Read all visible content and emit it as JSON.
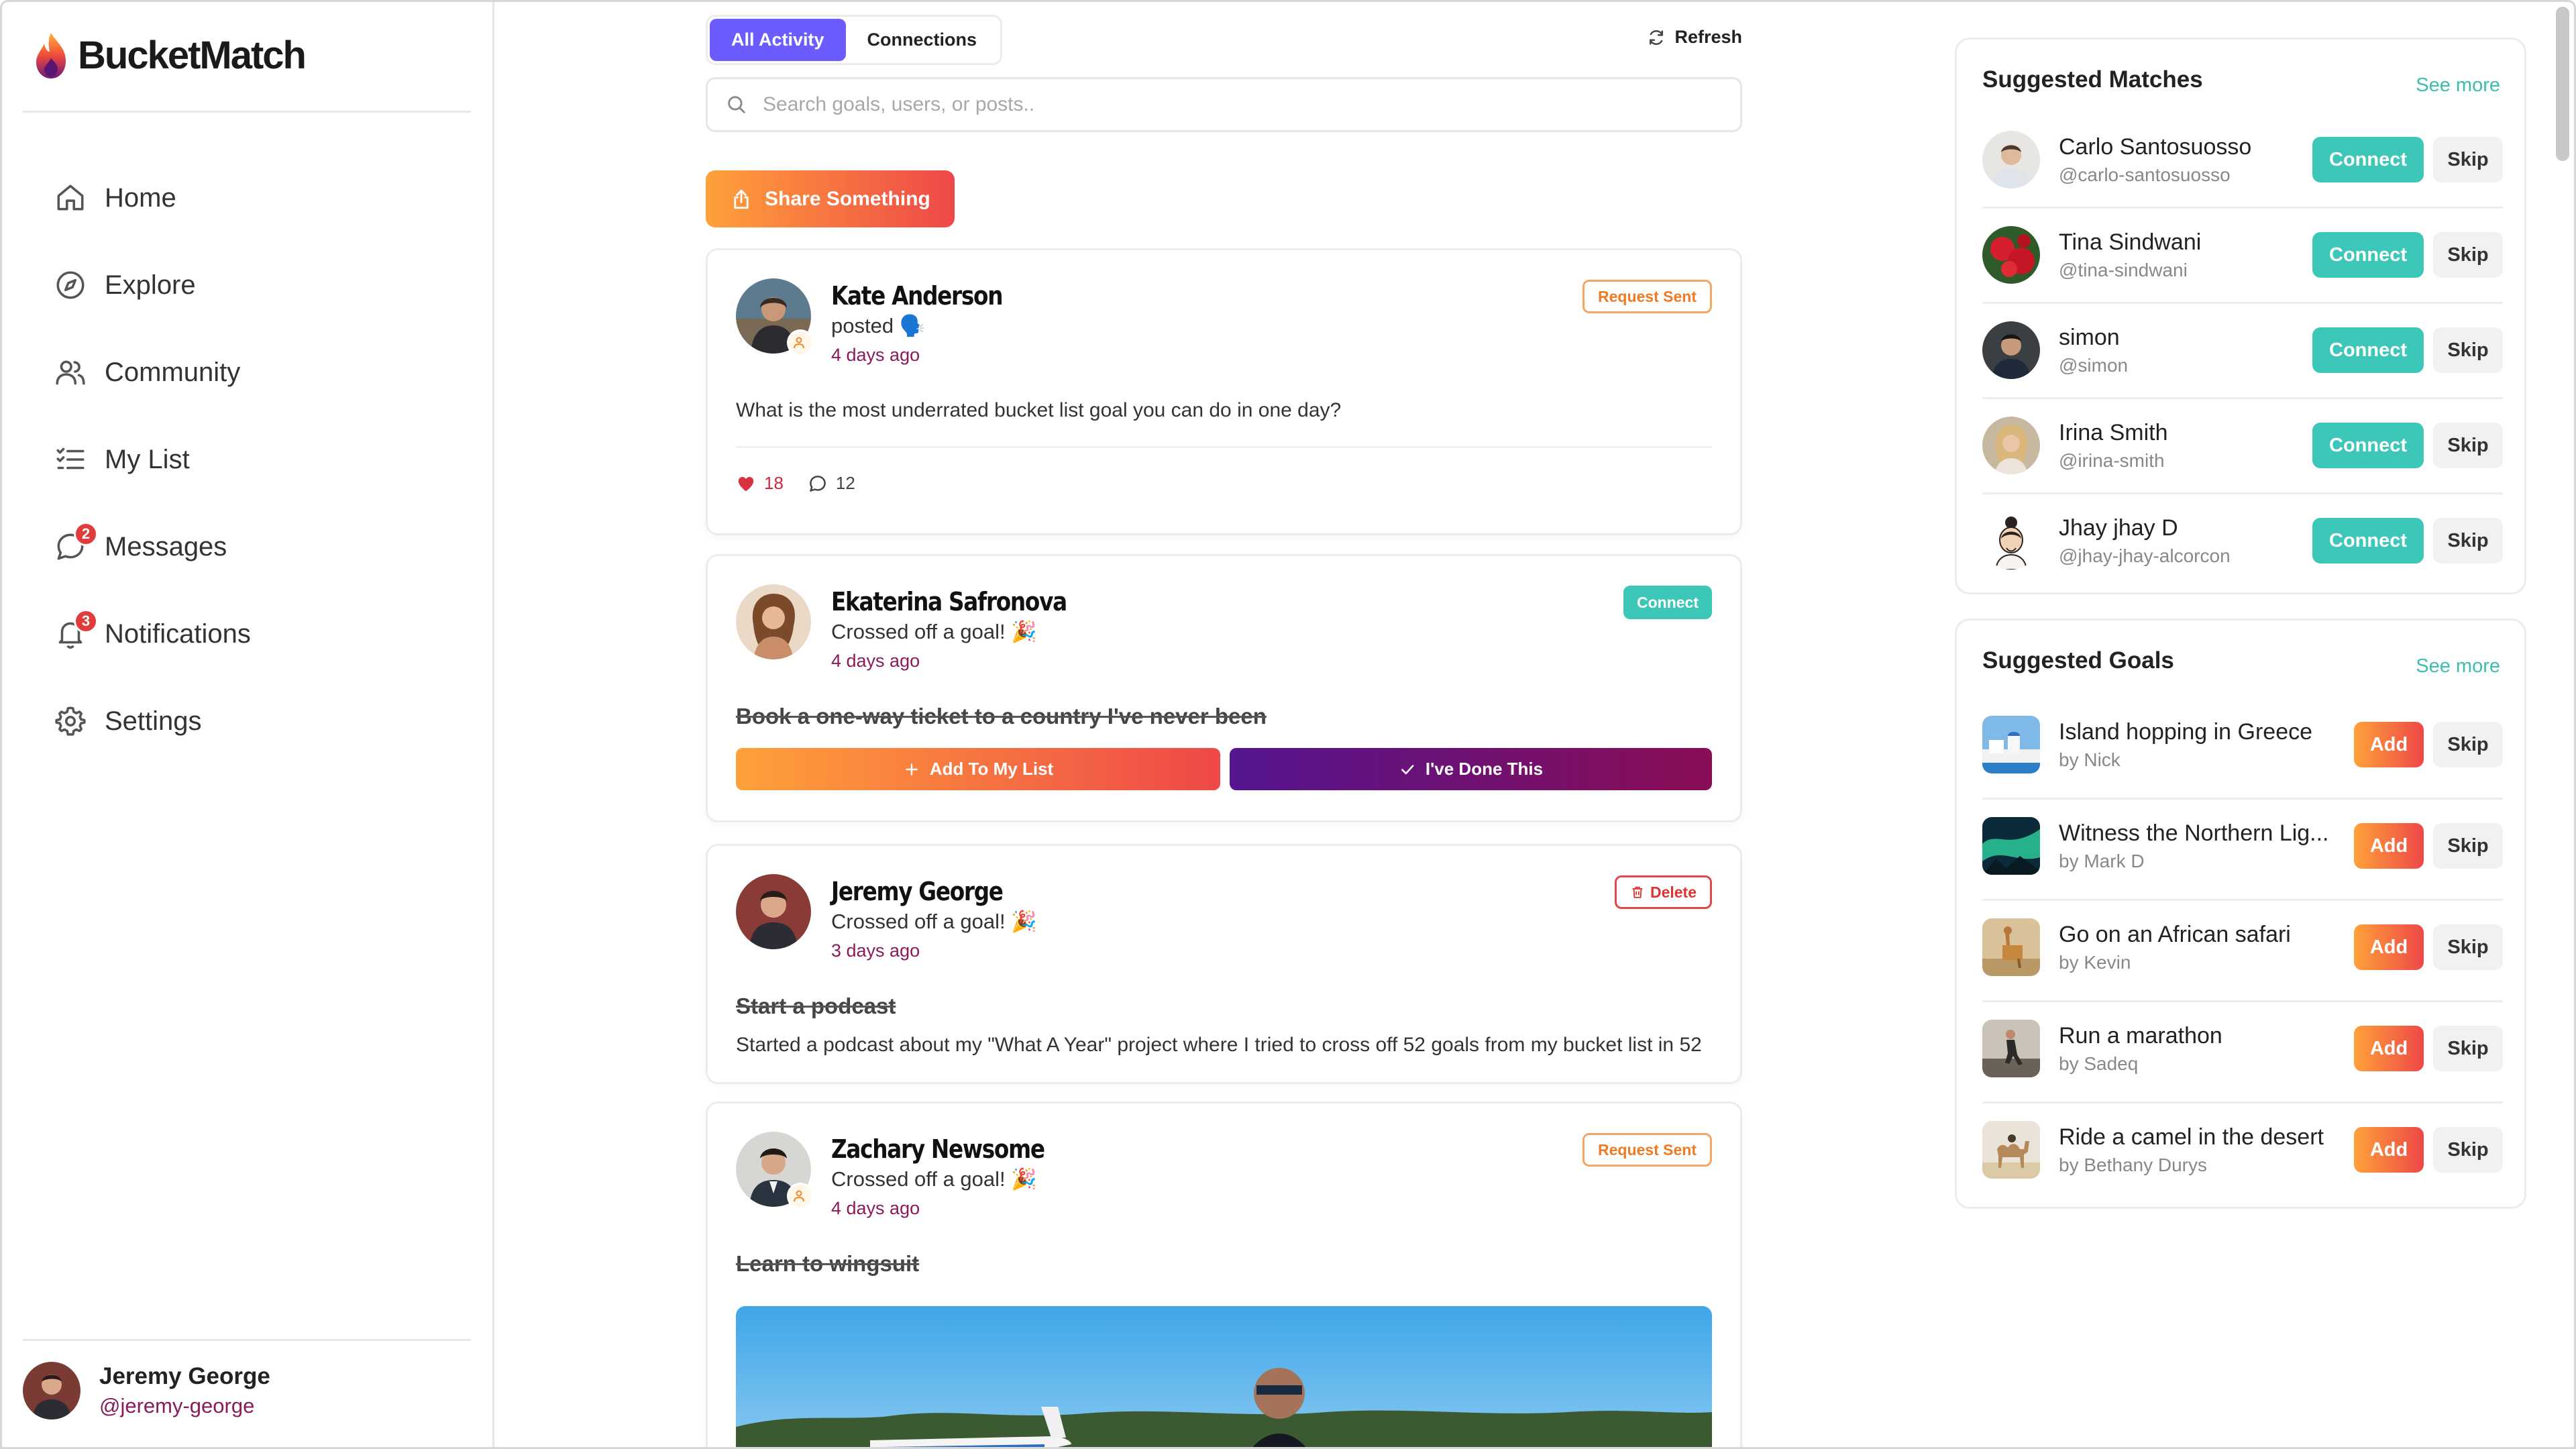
{
  "brand": {
    "name": "BucketMatch"
  },
  "sidebar": {
    "items": [
      {
        "label": "Home",
        "icon": "home-icon"
      },
      {
        "label": "Explore",
        "icon": "compass-icon"
      },
      {
        "label": "Community",
        "icon": "users-icon"
      },
      {
        "label": "My List",
        "icon": "checklist-icon"
      },
      {
        "label": "Messages",
        "icon": "message-icon",
        "badge": "2"
      },
      {
        "label": "Notifications",
        "icon": "bell-icon",
        "badge": "3"
      },
      {
        "label": "Settings",
        "icon": "gear-icon"
      }
    ],
    "profile": {
      "name": "Jeremy George",
      "handle": "@jeremy-george"
    }
  },
  "feed": {
    "tabs": [
      {
        "label": "All Activity",
        "active": true
      },
      {
        "label": "Connections",
        "active": false
      }
    ],
    "refresh_label": "Refresh",
    "search_placeholder": "Search goals, users, or posts..",
    "share_label": "Share Something",
    "posts": [
      {
        "author": "Kate Anderson",
        "action": "posted 🗣️",
        "time": "4 days ago",
        "status": "Request Sent",
        "text": "What is the most underrated bucket list goal you can do in one day?",
        "likes": "18",
        "comments": "12"
      },
      {
        "author": "Ekaterina Safronova",
        "action": "Crossed off a goal! 🎉",
        "time": "4 days ago",
        "status": "Connect",
        "goal": "Book a one-way ticket to a country I've never been",
        "add_label": "Add To My List",
        "done_label": "I've Done This"
      },
      {
        "author": "Jeremy George",
        "action": "Crossed off a goal! 🎉",
        "time": "3 days ago",
        "status": "Delete",
        "goal": "Start a podcast",
        "text": "Started a podcast about my \"What A Year\" project where I tried to cross off 52 goals from my bucket list in 52"
      },
      {
        "author": "Zachary Newsome",
        "action": "Crossed off a goal! 🎉",
        "time": "4 days ago",
        "status": "Request Sent",
        "goal": "Learn to wingsuit"
      }
    ]
  },
  "suggested_matches": {
    "title": "Suggested Matches",
    "see_more": "See more",
    "connect_label": "Connect",
    "skip_label": "Skip",
    "items": [
      {
        "name": "Carlo Santosuosso",
        "handle": "@carlo-santosuosso"
      },
      {
        "name": "Tina Sindwani",
        "handle": "@tina-sindwani"
      },
      {
        "name": "simon",
        "handle": "@simon"
      },
      {
        "name": "Irina Smith",
        "handle": "@irina-smith"
      },
      {
        "name": "Jhay jhay D",
        "handle": "@jhay-jhay-alcorcon"
      }
    ]
  },
  "suggested_goals": {
    "title": "Suggested Goals",
    "see_more": "See more",
    "add_label": "Add",
    "skip_label": "Skip",
    "items": [
      {
        "title": "Island hopping in Greece",
        "by": "by Nick"
      },
      {
        "title": "Witness the Northern Lig...",
        "by": "by Mark D"
      },
      {
        "title": "Go on an African safari",
        "by": "by Kevin"
      },
      {
        "title": "Run a marathon",
        "by": "by Sadeq"
      },
      {
        "title": "Ride a camel in the desert",
        "by": "by Bethany Durys"
      }
    ]
  },
  "colors": {
    "accent_purple": "#6a5cff",
    "teal": "#3dc7b8",
    "orange": "#ffa13a",
    "red": "#ee4848",
    "handle_plum": "#8a1a5a"
  }
}
